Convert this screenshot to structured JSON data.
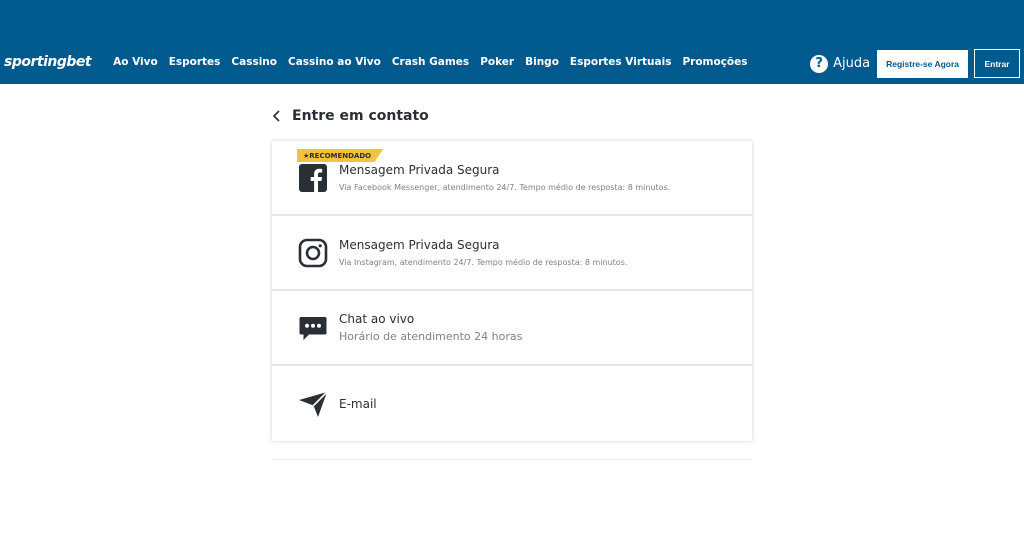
{
  "header": {
    "logo_text": "sportingbet",
    "menu": [
      "Ao Vivo",
      "Esportes",
      "Cassino",
      "Cassino ao Vivo",
      "Crash Games",
      "Poker",
      "Bingo",
      "Esportes Virtuais",
      "Promoções"
    ],
    "help_label": "Ajuda",
    "register_label": "Registre-se Agora",
    "login_label": "Entrar"
  },
  "page": {
    "title": "Entre em contato"
  },
  "contacts": [
    {
      "icon": "facebook-icon",
      "badge": "★RECOMENDADO",
      "title": "Mensagem Privada Segura",
      "subtitle": "Via Facebook Messenger, atendimento 24/7. Tempo médio de resposta: 8 minutos."
    },
    {
      "icon": "instagram-icon",
      "title": "Mensagem Privada Segura",
      "subtitle": "Via Instagram, atendimento 24/7. Tempo médio de resposta: 8 minutos."
    },
    {
      "icon": "chat-icon",
      "title": "Chat ao vivo",
      "subtitle": "Horário de atendimento 24 horas"
    },
    {
      "icon": "send-icon",
      "title": "E-mail"
    }
  ],
  "colors": {
    "brand": "#005a8d",
    "badge": "#f6c23e",
    "text": "#2a2f36"
  }
}
